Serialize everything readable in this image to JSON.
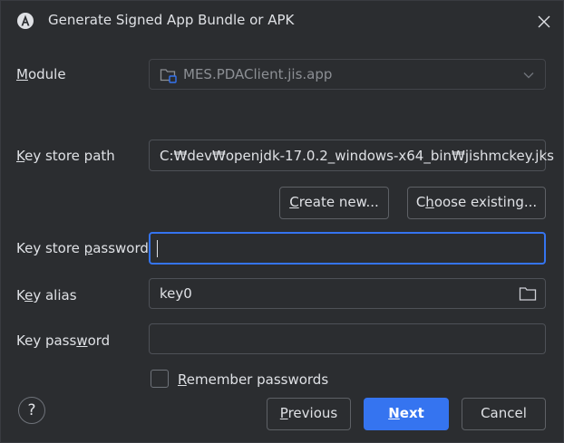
{
  "window": {
    "title": "Generate Signed App Bundle or APK"
  },
  "module": {
    "label": "Module",
    "value": "MES.PDAClient.jis.app"
  },
  "keystore": {
    "path_label": "Key store path",
    "path_value": "C:₩dev₩openjdk-17.0.2_windows-x64_bin₩jishmckey.jks",
    "create_new": "Create new...",
    "choose_existing": "Choose existing...",
    "password_label": "Key store password",
    "password_value": ""
  },
  "key": {
    "alias_label": "Key alias",
    "alias_value": "key0",
    "password_label": "Key password",
    "password_value": ""
  },
  "remember": {
    "label": "Remember passwords",
    "checked": false
  },
  "footer": {
    "help": "?",
    "previous": "Previous",
    "next": "Next",
    "cancel": "Cancel"
  },
  "colors": {
    "background": "#2b2d30",
    "accent": "#3574f0",
    "border": "#4e5157",
    "text": "#dfe1e5"
  }
}
